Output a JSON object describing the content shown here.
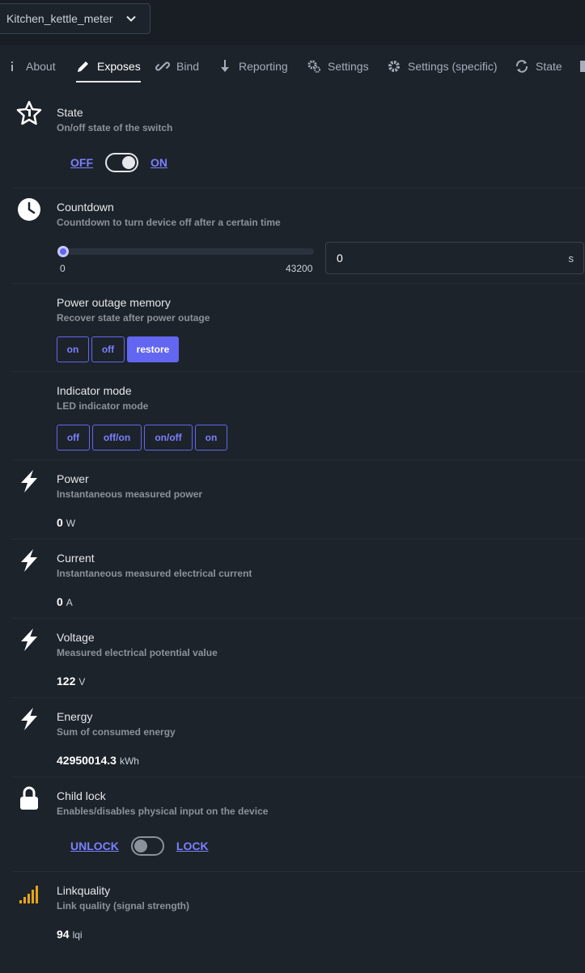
{
  "device": {
    "name": "Kitchen_kettle_meter"
  },
  "tabs": [
    {
      "label": "About",
      "icon": "info-icon"
    },
    {
      "label": "Exposes",
      "icon": "pencil-icon"
    },
    {
      "label": "Bind",
      "icon": "link-icon"
    },
    {
      "label": "Reporting",
      "icon": "download-arrow-icon"
    },
    {
      "label": "Settings",
      "icon": "cogs-icon"
    },
    {
      "label": "Settings (specific)",
      "icon": "gear-icon"
    },
    {
      "label": "State",
      "icon": "refresh-icon"
    }
  ],
  "active_tab": "Exposes",
  "exposes": {
    "state": {
      "title": "State",
      "desc": "On/off state of the switch",
      "off_label": "OFF",
      "on_label": "ON",
      "value": "ON"
    },
    "countdown": {
      "title": "Countdown",
      "desc": "Countdown to turn device off after a certain time",
      "min": "0",
      "max": "43200",
      "value": "0",
      "unit": "s"
    },
    "power_outage": {
      "title": "Power outage memory",
      "desc": "Recover state after power outage",
      "options": [
        "on",
        "off",
        "restore"
      ],
      "selected": "restore"
    },
    "indicator": {
      "title": "Indicator mode",
      "desc": "LED indicator mode",
      "options": [
        "off",
        "off/on",
        "on/off",
        "on"
      ]
    },
    "power": {
      "title": "Power",
      "desc": "Instantaneous measured power",
      "value": "0",
      "unit": "W"
    },
    "current": {
      "title": "Current",
      "desc": "Instantaneous measured electrical current",
      "value": "0",
      "unit": "A"
    },
    "voltage": {
      "title": "Voltage",
      "desc": "Measured electrical potential value",
      "value": "122",
      "unit": "V"
    },
    "energy": {
      "title": "Energy",
      "desc": "Sum of consumed energy",
      "value": "42950014.3",
      "unit": "kWh"
    },
    "child_lock": {
      "title": "Child lock",
      "desc": "Enables/disables physical input on the device",
      "off_label": "UNLOCK",
      "on_label": "LOCK",
      "value": "UNLOCK"
    },
    "linkquality": {
      "title": "Linkquality",
      "desc": "Link quality (signal strength)",
      "value": "94",
      "unit": "lqi"
    }
  },
  "colors": {
    "accent": "#6366f1",
    "link": "#7a80ff",
    "signal": "#e8a317",
    "background": "#1d232a"
  }
}
